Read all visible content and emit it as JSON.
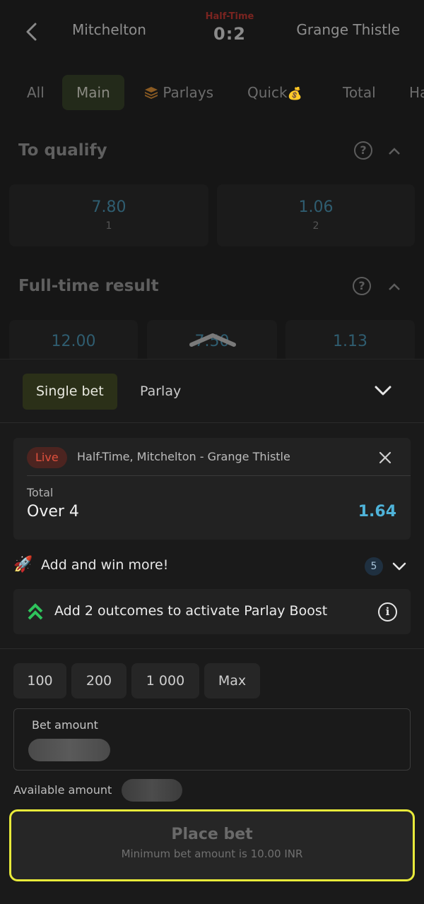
{
  "header": {
    "home_team": "Mitchelton",
    "away_team": "Grange Thistle",
    "period": "Half-Time",
    "score": "0:2"
  },
  "tabs": [
    {
      "label": "All"
    },
    {
      "label": "Main"
    },
    {
      "label": "Parlays",
      "icon": "stack-icon"
    },
    {
      "label": "Quick",
      "icon": "money-bag-icon"
    },
    {
      "label": "Total"
    },
    {
      "label": "Ha"
    }
  ],
  "markets": {
    "to_qualify": {
      "title": "To qualify",
      "odds": [
        {
          "value": "7.80",
          "label": "1"
        },
        {
          "value": "1.06",
          "label": "2"
        }
      ]
    },
    "full_time": {
      "title": "Full-time result",
      "odds": [
        {
          "value": "12.00"
        },
        {
          "value": "7.50"
        },
        {
          "value": "1.13"
        }
      ]
    }
  },
  "betslip": {
    "single_label": "Single bet",
    "parlay_label": "Parlay",
    "selection": {
      "live_label": "Live",
      "match": "Half-Time, Mitchelton - Grange Thistle",
      "market": "Total",
      "pick": "Over 4",
      "odd": "1.64"
    },
    "add_win_text": "Add and win more!",
    "add_win_count": "5",
    "boost_text": "Add 2 outcomes to activate Parlay Boost",
    "quick_amounts": [
      "100",
      "200",
      "1 000",
      "Max"
    ],
    "amount_label": "Bet amount",
    "available_label": "Available amount",
    "place_bet_label": "Place bet",
    "min_bet_text": "Minimum bet amount is 10.00 INR"
  },
  "colors": {
    "accent_odds": "#4fb3d9",
    "live_red": "#e0503d",
    "highlight_yellow": "#e8ea3a",
    "single_bet_bg": "#2b3018"
  }
}
